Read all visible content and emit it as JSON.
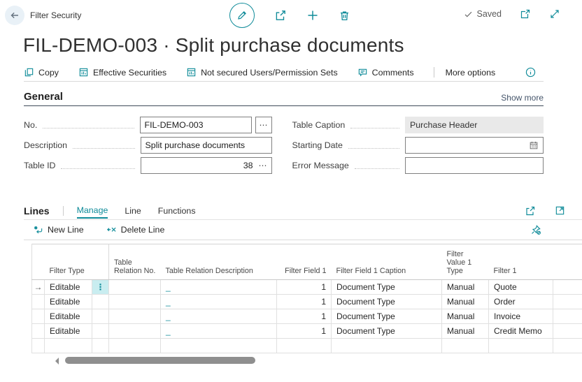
{
  "colors": {
    "accent": "#0f8b99",
    "accent_soft": "#c9edf0",
    "disabled_bg": "#e9e9e9"
  },
  "icons": {
    "assist_edit": "⋯",
    "row_indicator": "→",
    "row_options": "⋮"
  },
  "header": {
    "caption": "Filter Security",
    "saved_label": "Saved"
  },
  "title": "FIL-DEMO-003 · Split purchase documents",
  "action_bar": {
    "items": [
      {
        "label": "Copy"
      },
      {
        "label": "Effective Securities"
      },
      {
        "label": "Not secured Users/Permission Sets"
      },
      {
        "label": "Comments"
      }
    ],
    "more_options": "More options"
  },
  "general": {
    "heading": "General",
    "show_more": "Show more",
    "fields": {
      "no": {
        "label": "No.",
        "value": "FIL-DEMO-003"
      },
      "description": {
        "label": "Description",
        "value": "Split purchase documents"
      },
      "table_id": {
        "label": "Table ID",
        "value": "38"
      },
      "table_caption": {
        "label": "Table Caption",
        "value": "Purchase Header"
      },
      "starting_date": {
        "label": "Starting Date",
        "value": ""
      },
      "error_message": {
        "label": "Error Message",
        "value": ""
      }
    }
  },
  "lines": {
    "heading": "Lines",
    "tabs": {
      "manage": "Manage",
      "line": "Line",
      "functions": "Functions"
    },
    "toolbar": {
      "new_line": "New Line",
      "delete_line": "Delete Line"
    },
    "grid": {
      "columns": [
        "Filter Type",
        "Table Relation No.",
        "Table Relation Description",
        "Filter Field 1",
        "Filter Field 1 Caption",
        "Filter Value 1 Type",
        "Filter 1"
      ],
      "rows": [
        {
          "filter_type": "Editable",
          "table_relation_no": "",
          "table_relation_description": "_",
          "filter_field_1": 1,
          "filter_field_1_caption": "Document Type",
          "filter_value_1_type": "Manual",
          "filter_1": "Quote"
        },
        {
          "filter_type": "Editable",
          "table_relation_no": "",
          "table_relation_description": "_",
          "filter_field_1": 1,
          "filter_field_1_caption": "Document Type",
          "filter_value_1_type": "Manual",
          "filter_1": "Order"
        },
        {
          "filter_type": "Editable",
          "table_relation_no": "",
          "table_relation_description": "_",
          "filter_field_1": 1,
          "filter_field_1_caption": "Document Type",
          "filter_value_1_type": "Manual",
          "filter_1": "Invoice"
        },
        {
          "filter_type": "Editable",
          "table_relation_no": "",
          "table_relation_description": "_",
          "filter_field_1": 1,
          "filter_field_1_caption": "Document Type",
          "filter_value_1_type": "Manual",
          "filter_1": "Credit Memo"
        }
      ]
    }
  }
}
